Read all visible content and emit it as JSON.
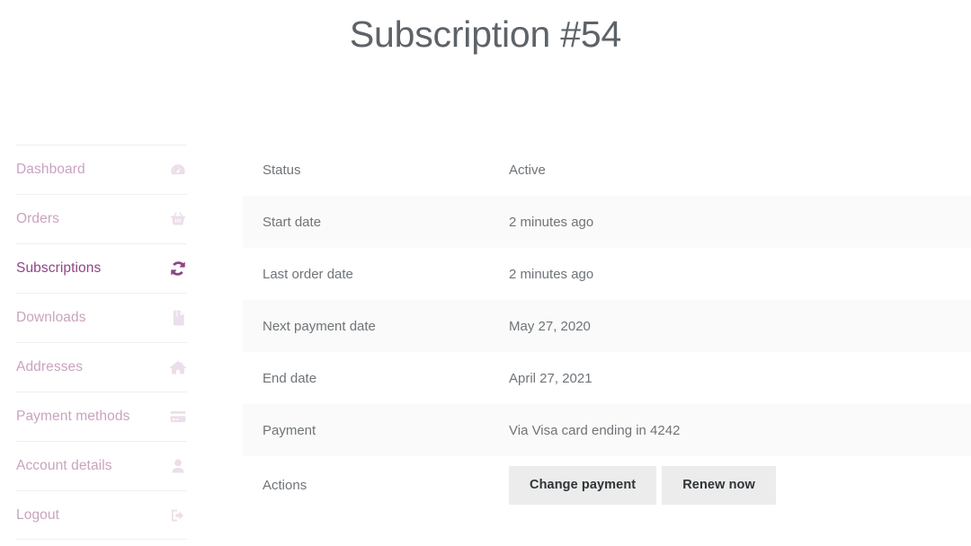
{
  "page": {
    "title": "Subscription #54"
  },
  "colors": {
    "accent_active": "#8e4585",
    "accent_muted": "#c9a3bf",
    "icon_muted": "#ecdeea",
    "text_body": "#6f7478",
    "title_text": "#5d6368",
    "row_alt_bg": "#fafafa",
    "button_bg": "#ececec",
    "button_text": "#2f3437",
    "divider": "#f0eef1"
  },
  "sidebar": {
    "items": [
      {
        "label": "Dashboard",
        "icon": "dashboard-gauge-icon",
        "active": false
      },
      {
        "label": "Orders",
        "icon": "shopping-basket-icon",
        "active": false
      },
      {
        "label": "Subscriptions",
        "icon": "refresh-sync-icon",
        "active": true
      },
      {
        "label": "Downloads",
        "icon": "zip-file-icon",
        "active": false
      },
      {
        "label": "Addresses",
        "icon": "home-icon",
        "active": false
      },
      {
        "label": "Payment methods",
        "icon": "credit-card-icon",
        "active": false
      },
      {
        "label": "Account details",
        "icon": "user-icon",
        "active": false
      },
      {
        "label": "Logout",
        "icon": "logout-arrow-icon",
        "active": false
      }
    ]
  },
  "details": {
    "rows": [
      {
        "label": "Status",
        "value": "Active"
      },
      {
        "label": "Start date",
        "value": "2 minutes ago"
      },
      {
        "label": "Last order date",
        "value": "2 minutes ago"
      },
      {
        "label": "Next payment date",
        "value": "May 27, 2020"
      },
      {
        "label": "End date",
        "value": "April 27, 2021"
      },
      {
        "label": "Payment",
        "value": "Via Visa card ending in 4242"
      }
    ],
    "actions": {
      "label": "Actions",
      "buttons": [
        {
          "label": "Change payment"
        },
        {
          "label": "Renew now"
        }
      ]
    }
  }
}
